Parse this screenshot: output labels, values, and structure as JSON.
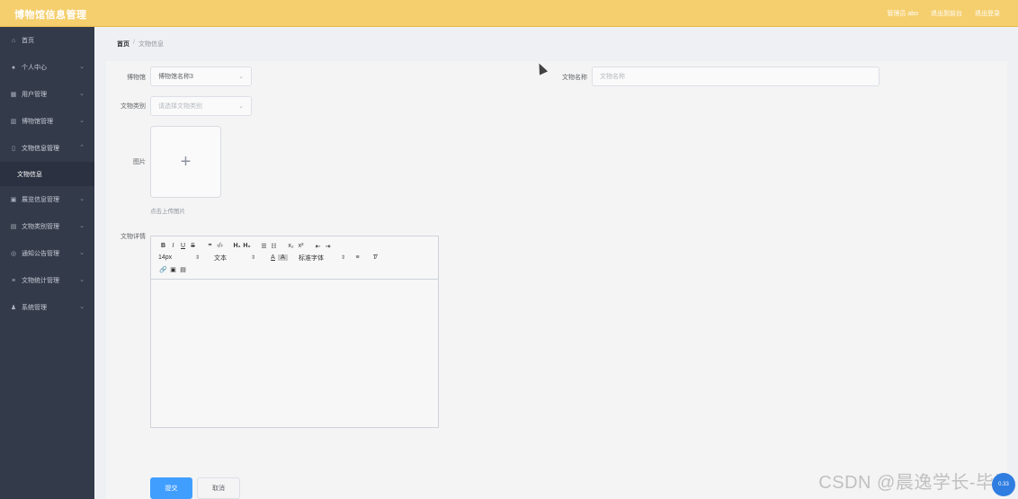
{
  "app": {
    "title": "博物馆信息管理"
  },
  "topnav": {
    "user": "管理员 abo",
    "back_to_front": "退出到前台",
    "logout": "退出登录"
  },
  "sidebar": {
    "items": [
      {
        "label": "首页",
        "icon": "home-icon"
      },
      {
        "label": "个人中心",
        "icon": "user-icon"
      },
      {
        "label": "用户管理",
        "icon": "users-icon"
      },
      {
        "label": "博物馆管理",
        "icon": "building-icon"
      },
      {
        "label": "文物信息管理",
        "icon": "relic-icon",
        "expanded": true,
        "children": [
          "文物信息"
        ]
      },
      {
        "label": "展览信息管理",
        "icon": "exhibit-icon"
      },
      {
        "label": "文物类别管理",
        "icon": "category-icon"
      },
      {
        "label": "通知公告管理",
        "icon": "notice-icon"
      },
      {
        "label": "文物统计管理",
        "icon": "stats-icon"
      },
      {
        "label": "系统管理",
        "icon": "settings-icon"
      }
    ]
  },
  "breadcrumb": {
    "home": "首页",
    "separator": "/",
    "current": "文物信息"
  },
  "form": {
    "museum": {
      "label": "博物馆",
      "value": "博物馆名称3"
    },
    "relic_name": {
      "label": "文物名称",
      "placeholder": "文物名称"
    },
    "category": {
      "label": "文物类别",
      "placeholder": "请选择文物类别"
    },
    "image": {
      "label": "图片",
      "tip": "点击上传图片"
    },
    "details": {
      "label": "文物详情"
    }
  },
  "editor": {
    "font_size": "14px",
    "paragraph": "文本",
    "font_family": "标准字体"
  },
  "buttons": {
    "submit": "提交",
    "cancel": "取消"
  },
  "watermark": "CSDN @晨逸学长-毕设",
  "badge": "0.33",
  "colors": {
    "header": "#f5cf6e",
    "sidebar": "#333a4a",
    "primary": "#409eff"
  }
}
